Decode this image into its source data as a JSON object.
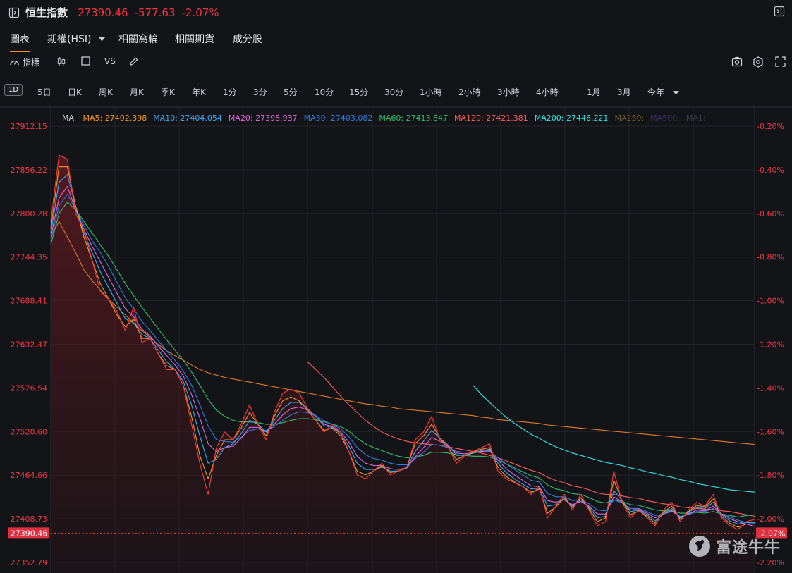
{
  "header": {
    "name": "恒生指數",
    "price": "27390.46",
    "change": "-577.63",
    "change_pct": "-2.07%",
    "down_color": "#f23645"
  },
  "tabs": [
    {
      "label": "圖表"
    },
    {
      "label": "期權(HSI)"
    },
    {
      "label": "相關窩輪"
    },
    {
      "label": "相關期貨"
    },
    {
      "label": "成分股"
    }
  ],
  "toolbar": {
    "indicators_label": "指標",
    "vs_label": "VS"
  },
  "periods": {
    "active": "1D",
    "items": [
      "5日",
      "日K",
      "周K",
      "月K",
      "季K",
      "年K",
      "1分",
      "3分",
      "5分",
      "10分",
      "15分",
      "30分",
      "1小時",
      "2小時",
      "3小時",
      "4小時"
    ],
    "extra": [
      "1月",
      "3月"
    ],
    "range_select": "今年"
  },
  "legend": {
    "title": "MA",
    "items": [
      {
        "text": "MA5: 27402.398",
        "color": "#f59a23"
      },
      {
        "text": "MA10: 27404.054",
        "color": "#3fa9f5"
      },
      {
        "text": "MA20: 27398.937",
        "color": "#e066e0"
      },
      {
        "text": "MA30: 27403.082",
        "color": "#2f7de1"
      },
      {
        "text": "MA60: 27413.847",
        "color": "#2fbf71"
      },
      {
        "text": "MA120: 27421.381",
        "color": "#ff5a5a"
      },
      {
        "text": "MA200: 27446.221",
        "color": "#2ee6e6"
      },
      {
        "text": "MA250:",
        "color": "#6b5a2a"
      },
      {
        "text": "MA500:",
        "color": "#3b2f63"
      },
      {
        "text": "MA1:",
        "color": "#3a3c42"
      }
    ]
  },
  "watermark": "富途牛牛",
  "chart_data": {
    "type": "line",
    "ylim": [
      27342,
      27924
    ],
    "y_tick_labels": [
      "27912.15",
      "27856.22",
      "27800.28",
      "27744.35",
      "27688.41",
      "27632.47",
      "27576.54",
      "27520.60",
      "27464.66",
      "27408.73",
      "27352.79"
    ],
    "y_right_tick_labels": [
      "-0.20%",
      "-0.40%",
      "-0.60%",
      "-0.80%",
      "-1.00%",
      "-1.20%",
      "-1.40%",
      "-1.60%",
      "-1.80%",
      "-2.00%",
      "-2.20%"
    ],
    "last_price": "27390.46",
    "last_pct": "-2.07%",
    "series": [
      {
        "name": "price",
        "color": "#ff3b3b",
        "values": [
          27790,
          27875,
          27870,
          27800,
          27780,
          27740,
          27700,
          27690,
          27675,
          27650,
          27680,
          27635,
          27640,
          27620,
          27600,
          27600,
          27580,
          27530,
          27480,
          27440,
          27500,
          27520,
          27510,
          27530,
          27555,
          27530,
          27510,
          27545,
          27570,
          27575,
          27570,
          27550,
          27535,
          27520,
          27530,
          27520,
          27495,
          27465,
          27460,
          27470,
          27480,
          27465,
          27470,
          27475,
          27510,
          27520,
          27540,
          27510,
          27500,
          27480,
          27490,
          27495,
          27500,
          27505,
          27470,
          27460,
          27455,
          27450,
          27440,
          27450,
          27410,
          27425,
          27440,
          27420,
          27440,
          27420,
          27400,
          27405,
          27470,
          27430,
          27410,
          27420,
          27410,
          27400,
          27420,
          27430,
          27405,
          27420,
          27430,
          27425,
          27440,
          27410,
          27400,
          27395,
          27405,
          27408
        ]
      },
      {
        "name": "MA5",
        "color": "#f59a23",
        "values": [
          27780,
          27860,
          27860,
          27810,
          27770,
          27740,
          27710,
          27690,
          27670,
          27655,
          27665,
          27640,
          27640,
          27620,
          27605,
          27600,
          27580,
          27540,
          27490,
          27460,
          27490,
          27510,
          27510,
          27525,
          27545,
          27530,
          27515,
          27540,
          27560,
          27565,
          27560,
          27548,
          27535,
          27522,
          27525,
          27515,
          27495,
          27470,
          27465,
          27470,
          27477,
          27468,
          27470,
          27475,
          27505,
          27515,
          27530,
          27512,
          27500,
          27485,
          27490,
          27494,
          27498,
          27500,
          27475,
          27463,
          27456,
          27450,
          27443,
          27447,
          27416,
          27424,
          27436,
          27423,
          27436,
          27422,
          27405,
          27410,
          27458,
          27432,
          27414,
          27419,
          27412,
          27403,
          27417,
          27425,
          27408,
          27418,
          27426,
          27424,
          27434,
          27412,
          27403,
          27398,
          27402,
          27402
        ]
      },
      {
        "name": "MA10",
        "color": "#3fa9f5",
        "values": [
          27775,
          27840,
          27850,
          27810,
          27775,
          27750,
          27725,
          27705,
          27685,
          27665,
          27660,
          27645,
          27640,
          27625,
          27610,
          27600,
          27585,
          27555,
          27515,
          27480,
          27485,
          27500,
          27505,
          27518,
          27535,
          27530,
          27520,
          27535,
          27550,
          27558,
          27558,
          27550,
          27540,
          27528,
          27526,
          27518,
          27502,
          27480,
          27472,
          27472,
          27475,
          27470,
          27470,
          27474,
          27495,
          27508,
          27522,
          27512,
          27503,
          27490,
          27490,
          27493,
          27496,
          27498,
          27480,
          27468,
          27460,
          27453,
          27447,
          27448,
          27425,
          27427,
          27434,
          27425,
          27433,
          27424,
          27410,
          27412,
          27445,
          27432,
          27418,
          27420,
          27414,
          27406,
          27415,
          27422,
          27410,
          27417,
          27423,
          27422,
          27430,
          27414,
          27406,
          27402,
          27404,
          27404
        ]
      },
      {
        "name": "MA20",
        "color": "#e066e0",
        "values": [
          27770,
          27820,
          27835,
          27805,
          27780,
          27758,
          27738,
          27718,
          27698,
          27678,
          27668,
          27652,
          27643,
          27630,
          27618,
          27606,
          27592,
          27568,
          27538,
          27505,
          27495,
          27500,
          27502,
          27512,
          27526,
          27526,
          27520,
          27530,
          27542,
          27550,
          27552,
          27548,
          27540,
          27530,
          27527,
          27520,
          27507,
          27489,
          27480,
          27477,
          27477,
          27473,
          27472,
          27474,
          27488,
          27500,
          27513,
          27508,
          27502,
          27493,
          27492,
          27493,
          27495,
          27496,
          27484,
          27473,
          27465,
          27458,
          27451,
          27450,
          27432,
          27430,
          27433,
          27427,
          27431,
          27425,
          27415,
          27415,
          27437,
          27430,
          27420,
          27421,
          27416,
          27410,
          27415,
          27419,
          27411,
          27415,
          27420,
          27419,
          27425,
          27415,
          27409,
          27405,
          27402,
          27399
        ]
      },
      {
        "name": "MA30",
        "color": "#2f7de1",
        "values": [
          27765,
          27810,
          27825,
          27805,
          27785,
          27765,
          27750,
          27732,
          27712,
          27692,
          27678,
          27662,
          27650,
          27637,
          27624,
          27612,
          27598,
          27580,
          27555,
          27528,
          27510,
          27508,
          27507,
          27513,
          27522,
          27524,
          27522,
          27527,
          27535,
          27542,
          27546,
          27545,
          27541,
          27534,
          27530,
          27524,
          27514,
          27500,
          27491,
          27486,
          27484,
          27480,
          27478,
          27478,
          27486,
          27494,
          27504,
          27503,
          27500,
          27495,
          27494,
          27494,
          27495,
          27495,
          27487,
          27479,
          27472,
          27465,
          27458,
          27456,
          27441,
          27437,
          27437,
          27432,
          27433,
          27428,
          27420,
          27419,
          27433,
          27429,
          27422,
          27422,
          27418,
          27413,
          27415,
          27418,
          27412,
          27414,
          27418,
          27418,
          27422,
          27415,
          27411,
          27407,
          27404,
          27403
        ]
      },
      {
        "name": "MA60",
        "color": "#2fbf71",
        "values": [
          27760,
          27800,
          27815,
          27805,
          27790,
          27775,
          27760,
          27745,
          27728,
          27710,
          27695,
          27680,
          27666,
          27652,
          27638,
          27625,
          27612,
          27597,
          27580,
          27562,
          27548,
          27540,
          27535,
          27533,
          27533,
          27532,
          27530,
          27530,
          27532,
          27535,
          27537,
          27537,
          27536,
          27533,
          27530,
          27527,
          27521,
          27512,
          27505,
          27500,
          27496,
          27492,
          27489,
          27487,
          27488,
          27490,
          27494,
          27494,
          27493,
          27491,
          27490,
          27489,
          27489,
          27488,
          27484,
          27479,
          27474,
          27469,
          27464,
          27461,
          27452,
          27447,
          27445,
          27441,
          27440,
          27436,
          27431,
          27429,
          27433,
          27431,
          27427,
          27426,
          27423,
          27420,
          27419,
          27419,
          27416,
          27416,
          27417,
          27416,
          27418,
          27415,
          27413,
          27411,
          27413,
          27414
        ]
      },
      {
        "name": "MA120",
        "color": "#ff5a5a",
        "values": [
          null,
          null,
          null,
          null,
          null,
          null,
          null,
          null,
          null,
          null,
          null,
          null,
          null,
          null,
          null,
          null,
          null,
          null,
          null,
          null,
          null,
          null,
          null,
          null,
          null,
          null,
          null,
          null,
          null,
          null,
          null,
          27610,
          27600,
          27590,
          27578,
          27566,
          27555,
          27545,
          27535,
          27527,
          27520,
          27515,
          27511,
          27508,
          27506,
          27505,
          27504,
          27503,
          27501,
          27499,
          27497,
          27495,
          27493,
          27490,
          27487,
          27483,
          27479,
          27475,
          27471,
          27468,
          27462,
          27458,
          27455,
          27451,
          27449,
          27446,
          27442,
          27440,
          27440,
          27438,
          27436,
          27435,
          27432,
          27430,
          27428,
          27427,
          27424,
          27423,
          27422,
          27421,
          27421,
          27419,
          27418,
          27416,
          27414,
          27412
        ]
      },
      {
        "name": "MA200",
        "color": "#2ee6e6",
        "values": [
          null,
          null,
          null,
          null,
          null,
          null,
          null,
          null,
          null,
          null,
          null,
          null,
          null,
          null,
          null,
          null,
          null,
          null,
          null,
          null,
          null,
          null,
          null,
          null,
          null,
          null,
          null,
          null,
          null,
          null,
          null,
          null,
          null,
          null,
          null,
          null,
          null,
          null,
          null,
          null,
          null,
          null,
          null,
          null,
          null,
          null,
          null,
          null,
          null,
          null,
          null,
          27580,
          27568,
          27558,
          27548,
          27539,
          27531,
          27524,
          27517,
          27512,
          27506,
          27501,
          27497,
          27493,
          27490,
          27487,
          27484,
          27481,
          27479,
          27477,
          27474,
          27472,
          27469,
          27467,
          27464,
          27462,
          27459,
          27457,
          27454,
          27452,
          27450,
          27448,
          27446,
          27445,
          27444,
          27443
        ]
      },
      {
        "name": "day-avg",
        "color": "#e07b22",
        "values": [
          27770,
          27790,
          27770,
          27750,
          27728,
          27714,
          27702,
          27690,
          27680,
          27670,
          27660,
          27650,
          27641,
          27632,
          27624,
          27618,
          27612,
          27606,
          27600,
          27596,
          27593,
          27590,
          27588,
          27586,
          27584,
          27582,
          27580,
          27578,
          27576,
          27574,
          27572,
          27570,
          27568,
          27566,
          27564,
          27562,
          27560,
          27558,
          27556,
          27555,
          27553,
          27552,
          27550,
          27549,
          27548,
          27547,
          27546,
          27545,
          27544,
          27543,
          27542,
          27541,
          27539,
          27538,
          27536,
          27535,
          27534,
          27533,
          27532,
          27531,
          27529,
          27528,
          27527,
          27526,
          27525,
          27524,
          27523,
          27522,
          27521,
          27520,
          27519,
          27518,
          27517,
          27516,
          27515,
          27514,
          27513,
          27512,
          27511,
          27510,
          27509,
          27508,
          27507,
          27506,
          27505,
          27504
        ]
      }
    ]
  }
}
